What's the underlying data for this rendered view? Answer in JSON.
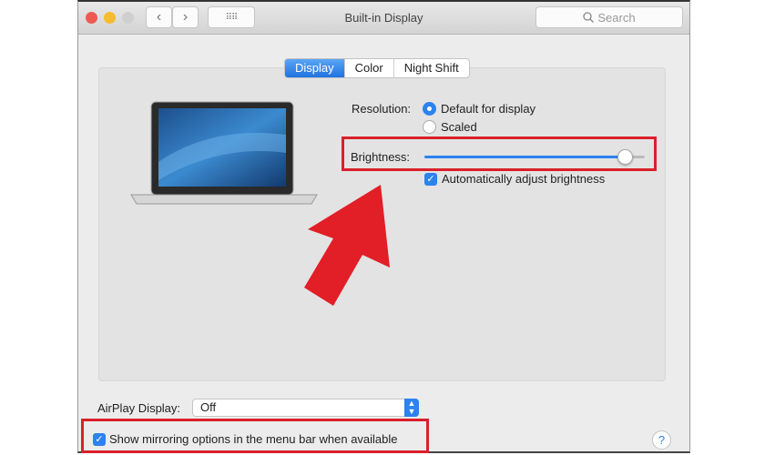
{
  "window": {
    "title": "Built-in Display",
    "search_placeholder": "Search"
  },
  "tabs": [
    {
      "label": "Display",
      "active": true
    },
    {
      "label": "Color",
      "active": false
    },
    {
      "label": "Night Shift",
      "active": false
    }
  ],
  "resolution": {
    "label": "Resolution:",
    "options": [
      {
        "label": "Default for display",
        "selected": true
      },
      {
        "label": "Scaled",
        "selected": false
      }
    ]
  },
  "brightness": {
    "label": "Brightness:",
    "value_percent": 91
  },
  "auto_brightness": {
    "label": "Automatically adjust brightness",
    "checked": true
  },
  "airplay": {
    "label": "AirPlay Display:",
    "value": "Off"
  },
  "mirroring": {
    "label": "Show mirroring options in the menu bar when available",
    "checked": true
  },
  "help": {
    "label": "?"
  },
  "colors": {
    "accent": "#2c82ef",
    "highlight": "#d9202a"
  }
}
